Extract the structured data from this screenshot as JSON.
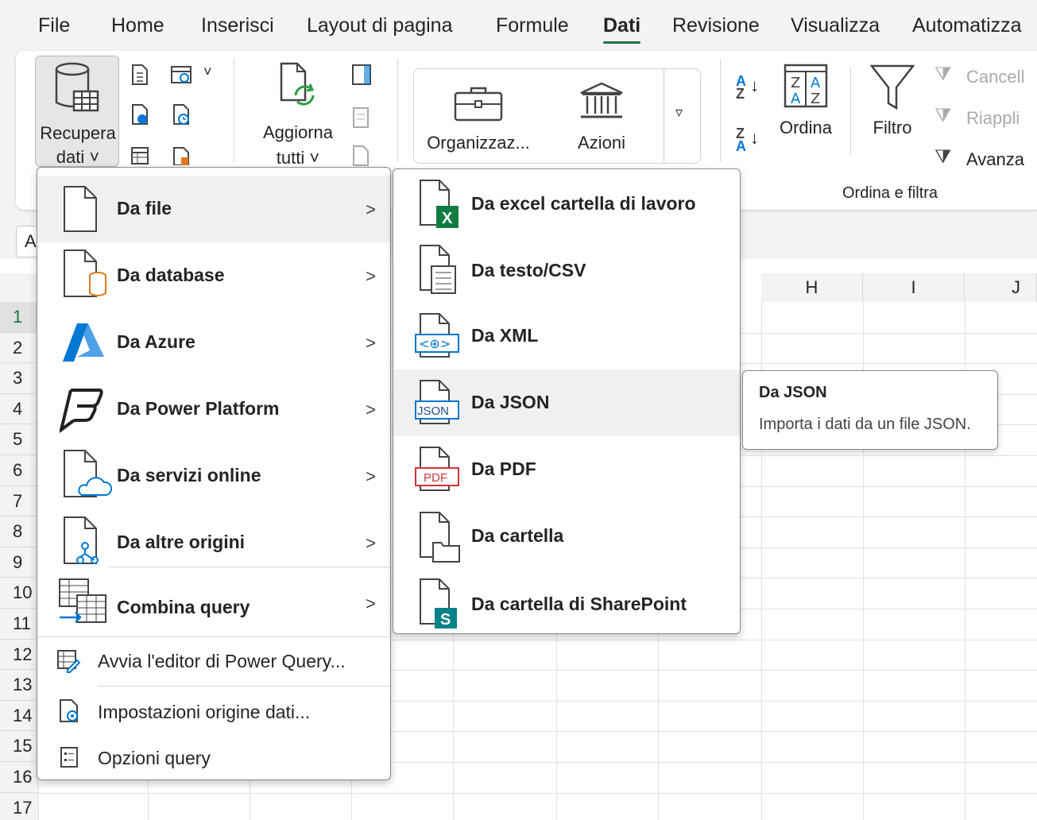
{
  "menubar": {
    "tabs": [
      {
        "label": "File"
      },
      {
        "label": "Home"
      },
      {
        "label": "Inserisci"
      },
      {
        "label": "Layout di pagina"
      },
      {
        "label": "Formule"
      },
      {
        "label": "Dati",
        "active": true
      },
      {
        "label": "Revisione"
      },
      {
        "label": "Visualizza"
      },
      {
        "label": "Automatizza"
      }
    ]
  },
  "ribbon": {
    "get_data": {
      "line1": "Recupera",
      "line2": "dati ˅"
    },
    "refresh_all": {
      "line1": "Aggiorna",
      "line2": "tutti ˅"
    },
    "data_types": [
      {
        "label": "Organizzaz..."
      },
      {
        "label": "Azioni"
      }
    ],
    "sort": {
      "label": "Ordina"
    },
    "filter": {
      "label": "Filtro"
    },
    "clear": {
      "label": "Cancell"
    },
    "reapply": {
      "label": "Riappli"
    },
    "advanced": {
      "label": "Avanza"
    },
    "group_sort_filter": "Ordina e filtra"
  },
  "namebox": {
    "value": "A"
  },
  "grid": {
    "columns": [
      "H",
      "I",
      "J"
    ],
    "rows": [
      "1",
      "2",
      "3",
      "4",
      "5",
      "6",
      "7",
      "8",
      "9",
      "10",
      "11",
      "12",
      "13",
      "14",
      "15",
      "16",
      "17"
    ]
  },
  "get_data_menu": {
    "items": [
      {
        "label": "Da file",
        "icon": "file-icon",
        "submenu": true,
        "highlighted": true
      },
      {
        "label": "Da database",
        "icon": "database-file-icon",
        "submenu": true
      },
      {
        "label": "Da Azure",
        "icon": "azure-icon",
        "submenu": true
      },
      {
        "label": "Da Power Platform",
        "icon": "power-platform-icon",
        "submenu": true
      },
      {
        "label": "Da servizi online",
        "icon": "online-services-icon",
        "submenu": true
      },
      {
        "label": "Da altre origini",
        "icon": "other-sources-icon",
        "submenu": true
      },
      {
        "label": "Combina query",
        "icon": "combine-query-icon",
        "submenu": true
      }
    ],
    "commands": [
      {
        "label": "Avvia l'editor di Power Query...",
        "icon": "power-query-editor-icon"
      },
      {
        "label": "Impostazioni origine dati...",
        "icon": "data-source-settings-icon"
      },
      {
        "label": "Opzioni query",
        "icon": "query-options-icon"
      }
    ]
  },
  "from_file_menu": {
    "items": [
      {
        "label": "Da excel cartella di lavoro",
        "icon": "excel-workbook-icon"
      },
      {
        "label": "Da testo/CSV",
        "icon": "text-csv-icon"
      },
      {
        "label": "Da XML",
        "icon": "xml-icon"
      },
      {
        "label": "Da JSON",
        "icon": "json-icon",
        "highlighted": true
      },
      {
        "label": "Da PDF",
        "icon": "pdf-icon"
      },
      {
        "label": "Da cartella",
        "icon": "folder-icon"
      },
      {
        "label": "Da cartella di SharePoint",
        "icon": "sharepoint-folder-icon"
      }
    ],
    "icon_badges": {
      "excel": "X",
      "json": "JSON",
      "pdf": "PDF",
      "sharepoint": "S",
      "xml": "<⊕>"
    }
  },
  "tooltip": {
    "title": "Da JSON",
    "description": "Importa i dati da un file JSON."
  },
  "colors": {
    "accent_green": "#1e7145",
    "excel_green": "#107c41",
    "sharepoint_teal": "#038387",
    "azure_blue": "#0078d4",
    "pdf_red": "#d13438",
    "database_orange": "#e07b1a",
    "refresh_green": "#2e9e44"
  }
}
